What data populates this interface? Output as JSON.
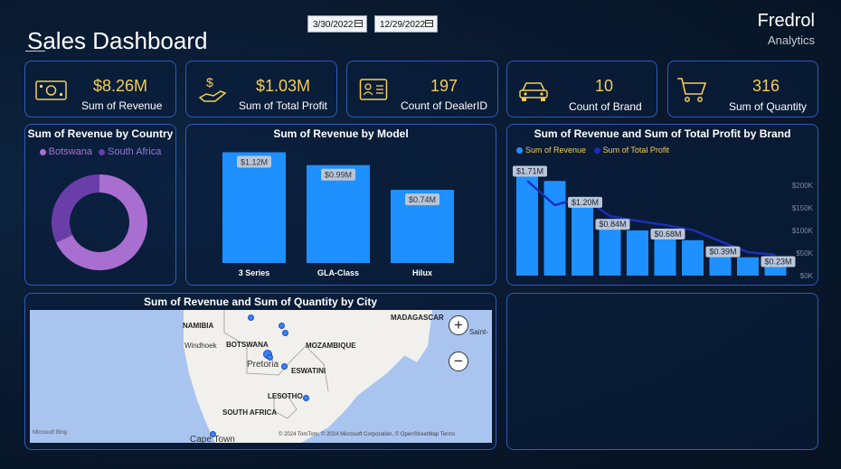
{
  "header": {
    "title": "Sales Dashboard",
    "start_date": "3/30/2022",
    "end_date": "12/29/2022",
    "brand_name": "Fredrol",
    "brand_sub": "Analytics"
  },
  "kpis": [
    {
      "value": "$8.26M",
      "label": "Sum of Revenue",
      "icon": "cash-icon"
    },
    {
      "value": "$1.03M",
      "label": "Sum of Total Profit",
      "icon": "hand-dollar-icon"
    },
    {
      "value": "197",
      "label": "Count of DealerID",
      "icon": "id-card-icon"
    },
    {
      "value": "10",
      "label": "Count of Brand",
      "icon": "car-icon"
    },
    {
      "value": "316",
      "label": "Sum of Quantity",
      "icon": "cart-icon"
    }
  ],
  "colors": {
    "accent_value": "#f5cd55",
    "bar": "#1e90ff",
    "line": "#1a2fb8",
    "donut_botswana": "#a86fd0",
    "donut_south_africa": "#6a3ea8",
    "panel_border": "#2e5bb8"
  },
  "chart_data": [
    {
      "type": "pie",
      "title": "Sum of Revenue by Country",
      "categories": [
        "Botswana",
        "South Africa"
      ],
      "values": [
        68,
        32
      ],
      "legend_position": "top"
    },
    {
      "type": "bar",
      "title": "Sum of Revenue by Model",
      "categories": [
        "3 Series",
        "GLA-Class",
        "Hilux"
      ],
      "values": [
        1.12,
        0.99,
        0.74
      ],
      "data_labels": [
        "$1.12M",
        "$0.99M",
        "$0.74M"
      ],
      "ylim": [
        0,
        1.2
      ]
    },
    {
      "type": "bar",
      "title": "Sum of Revenue and Sum of Total Profit by Brand",
      "series": [
        {
          "name": "Sum of Revenue",
          "values": [
            1.71,
            1.55,
            1.2,
            0.84,
            0.74,
            0.68,
            0.58,
            0.39,
            0.3,
            0.23
          ]
        },
        {
          "name": "Sum of Total Profit",
          "values": [
            210,
            156,
            173,
            132,
            121,
            112,
            101,
            76,
            52,
            46
          ]
        }
      ],
      "data_labels": [
        "$1.71M",
        "$1.20M",
        "$0.84M",
        "$0.68M",
        "$0.39M",
        "$0.23M"
      ],
      "y2_ticks": [
        "$200K",
        "$150K",
        "$100K",
        "$50K",
        "$0K"
      ],
      "y2lim": [
        0,
        250
      ],
      "ylim": [
        0,
        1.85
      ],
      "legend_position": "top-left"
    }
  ],
  "map": {
    "title": "Sum of Revenue and Sum of Quantity by City",
    "labels": [
      "NAMIBIA",
      "Windhoek",
      "BOTSWANA",
      "MOZAMBIQUE",
      "Pretoria",
      "ESWATINI",
      "LESOTHO",
      "SOUTH AFRICA",
      "Cape Town",
      "MADAGASCAR",
      "Saint-"
    ],
    "attribution": "© 2024 TomTom, © 2024 Microsoft Corporation, © OpenStreetMap Terms",
    "bing": "Microsoft Bing"
  }
}
